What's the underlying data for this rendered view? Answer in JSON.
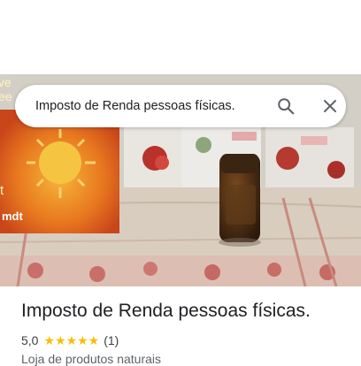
{
  "search": {
    "query": "Imposto de Renda pessoas físicas."
  },
  "place": {
    "name": "Imposto de Renda pessoas físicas.",
    "rating": "5,0",
    "stars": "★★★★★",
    "review_count": "(1)",
    "category": "Loja de produtos naturais"
  },
  "icons": {
    "search": "search-icon",
    "close": "close-icon"
  },
  "photo": {
    "box_text_top": "ve",
    "box_text_mid": "ee",
    "box_text_bottom": "mdt",
    "box_text_t": "t"
  }
}
